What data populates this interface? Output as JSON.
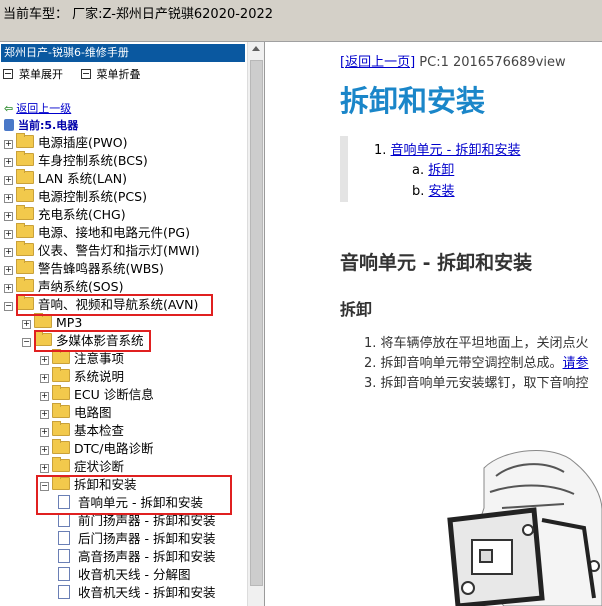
{
  "window": {
    "title": "当前车型：  厂家:Z-郑州日产锐骐62020-2022"
  },
  "left_panel": {
    "header": "郑州日产-锐骐6-维修手册",
    "menu": [
      "菜单展开",
      "菜单折叠"
    ],
    "back_link": "返回上一级",
    "current": "当前:5.电器",
    "tree": [
      {
        "label": "电源插座(PWO)",
        "level": 0,
        "expander": "+"
      },
      {
        "label": "车身控制系统(BCS)",
        "level": 0,
        "expander": "+"
      },
      {
        "label": "LAN 系统(LAN)",
        "level": 0,
        "expander": "+"
      },
      {
        "label": "电源控制系统(PCS)",
        "level": 0,
        "expander": "+"
      },
      {
        "label": "充电系统(CHG)",
        "level": 0,
        "expander": "+"
      },
      {
        "label": "电源、接地和电路元件(PG)",
        "level": 0,
        "expander": "+"
      },
      {
        "label": "仪表、警告灯和指示灯(MWI)",
        "level": 0,
        "expander": "+"
      },
      {
        "label": "警告蜂鸣器系统(WBS)",
        "level": 0,
        "expander": "+"
      },
      {
        "label": "声纳系统(SOS)",
        "level": 0,
        "expander": "+"
      },
      {
        "label": "音响、视频和导航系统(AVN)",
        "level": 0,
        "expander": "-"
      },
      {
        "label": "MP3",
        "level": 1,
        "expander": "+"
      },
      {
        "label": "多媒体影音系统",
        "level": 1,
        "expander": "-"
      },
      {
        "label": "注意事项",
        "level": 2,
        "expander": "+"
      },
      {
        "label": "系统说明",
        "level": 2,
        "expander": "+"
      },
      {
        "label": "ECU 诊断信息",
        "level": 2,
        "expander": "+"
      },
      {
        "label": "电路图",
        "level": 2,
        "expander": "+"
      },
      {
        "label": "基本检查",
        "level": 2,
        "expander": "+"
      },
      {
        "label": "DTC/电路诊断",
        "level": 2,
        "expander": "+"
      },
      {
        "label": "症状诊断",
        "level": 2,
        "expander": "+"
      },
      {
        "label": "拆卸和安装",
        "level": 2,
        "expander": "-"
      },
      {
        "label": "音响单元 - 拆卸和安装",
        "level": 3,
        "expander": ""
      },
      {
        "label": "前门扬声器 - 拆卸和安装",
        "level": 3,
        "expander": ""
      },
      {
        "label": "后门扬声器 - 拆卸和安装",
        "level": 3,
        "expander": ""
      },
      {
        "label": "高音扬声器 - 拆卸和安装",
        "level": 3,
        "expander": ""
      },
      {
        "label": "收音机天线 - 分解图",
        "level": 3,
        "expander": ""
      },
      {
        "label": "收音机天线 - 拆卸和安装",
        "level": 3,
        "expander": ""
      }
    ]
  },
  "content": {
    "nav_link": "[返回上一页]",
    "nav_info": " PC:1 2016576689view",
    "title": "拆卸和安装",
    "toc": {
      "item1_num": "1.",
      "item1": "音响单元 - 拆卸和安装",
      "item1a_num": "a.",
      "item1a": "拆卸",
      "item1b_num": "b.",
      "item1b": "安装"
    },
    "section_title": "音响单元 - 拆卸和安装",
    "sub_title": "拆卸",
    "steps": [
      "1. 将车辆停放在平坦地面上，关闭点火",
      "2. 拆卸音响单元带空调控制总成。请参",
      "3. 拆卸音响单元安装螺钉，取下音响控"
    ],
    "step2_link": "请参"
  },
  "colors": {
    "panel_header": "#0a58a0",
    "title_blue": "#1a86c9",
    "link": "#0000cc",
    "highlight": "#e02020"
  }
}
